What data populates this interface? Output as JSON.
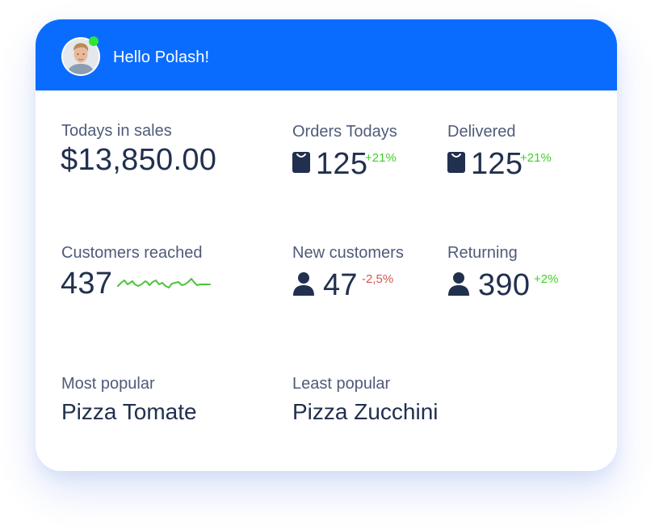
{
  "header": {
    "greeting": "Hello Polash!",
    "online_status_color": "#2ee53a",
    "accent": "#0a6cff"
  },
  "stats": {
    "sales": {
      "label": "Todays in sales",
      "value": "$13,850.00"
    },
    "orders": {
      "label": "Orders Todays",
      "value": "125",
      "change": "+21%",
      "icon": "bag-icon"
    },
    "delivered": {
      "label": "Delivered",
      "value": "125",
      "change": "+21%",
      "icon": "bag-icon"
    },
    "customers": {
      "label": "Customers reached",
      "value": "437",
      "trend_icon": "sparkline-icon"
    },
    "new_customers": {
      "label": "New customers",
      "value": "47",
      "change": "-2,5%",
      "icon": "user-icon"
    },
    "returning": {
      "label": "Returning",
      "value": "390",
      "change": "+2%",
      "icon": "user-icon"
    }
  },
  "popularity": {
    "most": {
      "label": "Most popular",
      "value": "Pizza Tomate"
    },
    "least": {
      "label": "Least popular",
      "value": "Pizza Zucchini"
    }
  },
  "colors": {
    "positive": "#3ed125",
    "negative": "#d9544f",
    "text_primary": "#22304f",
    "text_secondary": "#4f5b7a"
  }
}
